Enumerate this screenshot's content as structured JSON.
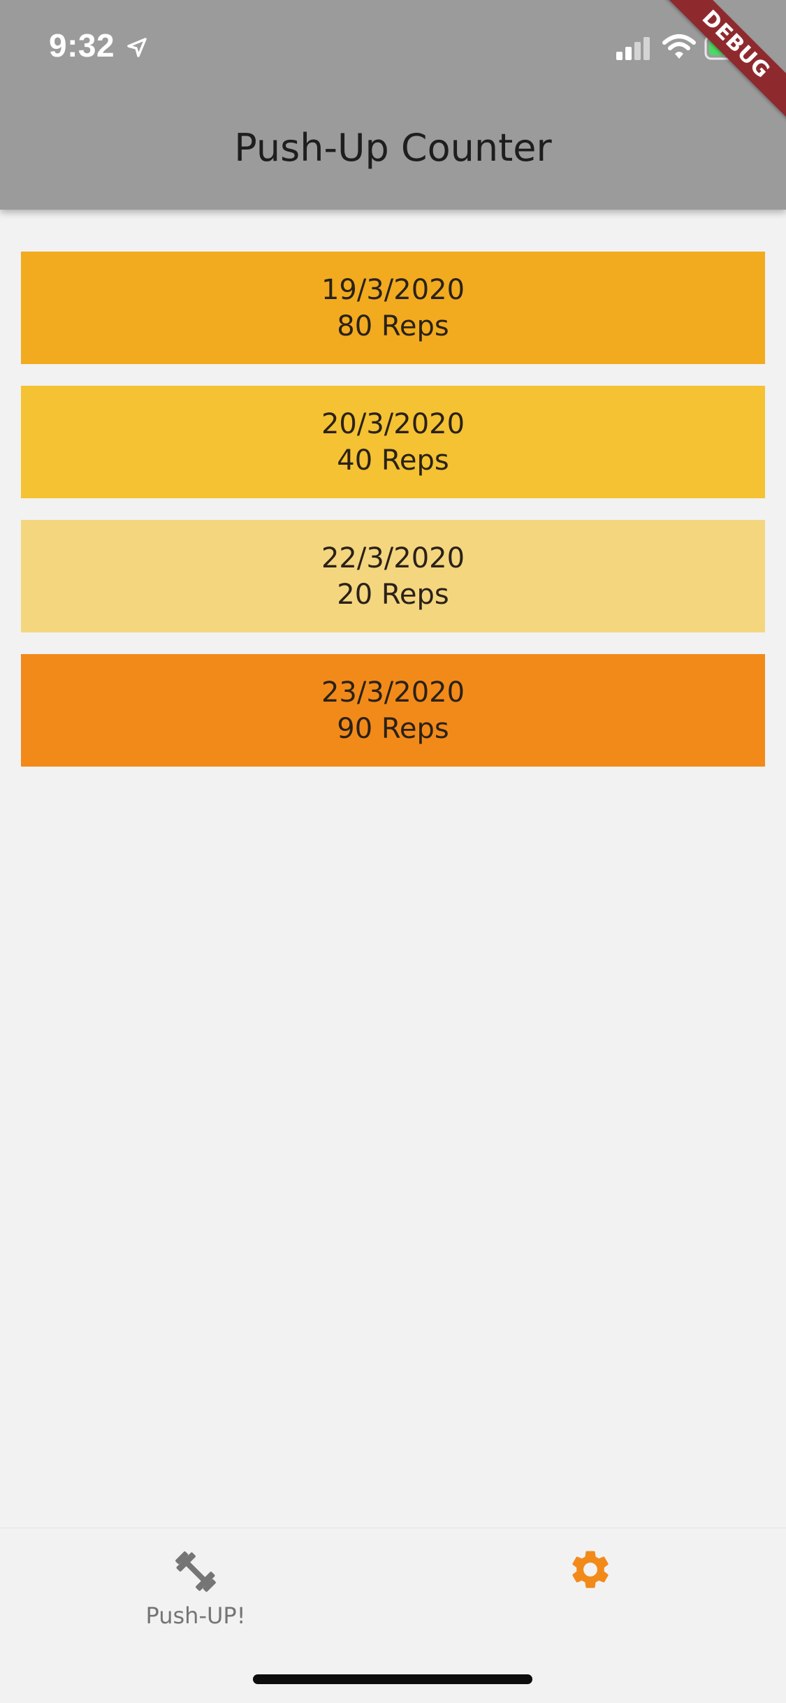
{
  "status_bar": {
    "time": "9:32"
  },
  "debug_banner": "DEBUG",
  "app_bar": {
    "title": "Push-Up Counter"
  },
  "entries": [
    {
      "date": "19/3/2020",
      "reps": "80 Reps",
      "color": "#f2ab1f"
    },
    {
      "date": "20/3/2020",
      "reps": "40 Reps",
      "color": "#f4c232"
    },
    {
      "date": "22/3/2020",
      "reps": "20 Reps",
      "color": "#f4d67f"
    },
    {
      "date": "23/3/2020",
      "reps": "90 Reps",
      "color": "#f28a1a"
    }
  ],
  "bottom_nav": {
    "items": [
      {
        "label": "Push-UP!",
        "icon": "dumbbell-icon",
        "color": "#757575"
      },
      {
        "icon": "gear-icon",
        "color": "#f28a1a"
      }
    ]
  },
  "colors": {
    "app_bar": "#9b9b9b",
    "background": "#f2f2f2",
    "accent": "#f28a1a",
    "debug_banner": "#8e2a2e"
  }
}
